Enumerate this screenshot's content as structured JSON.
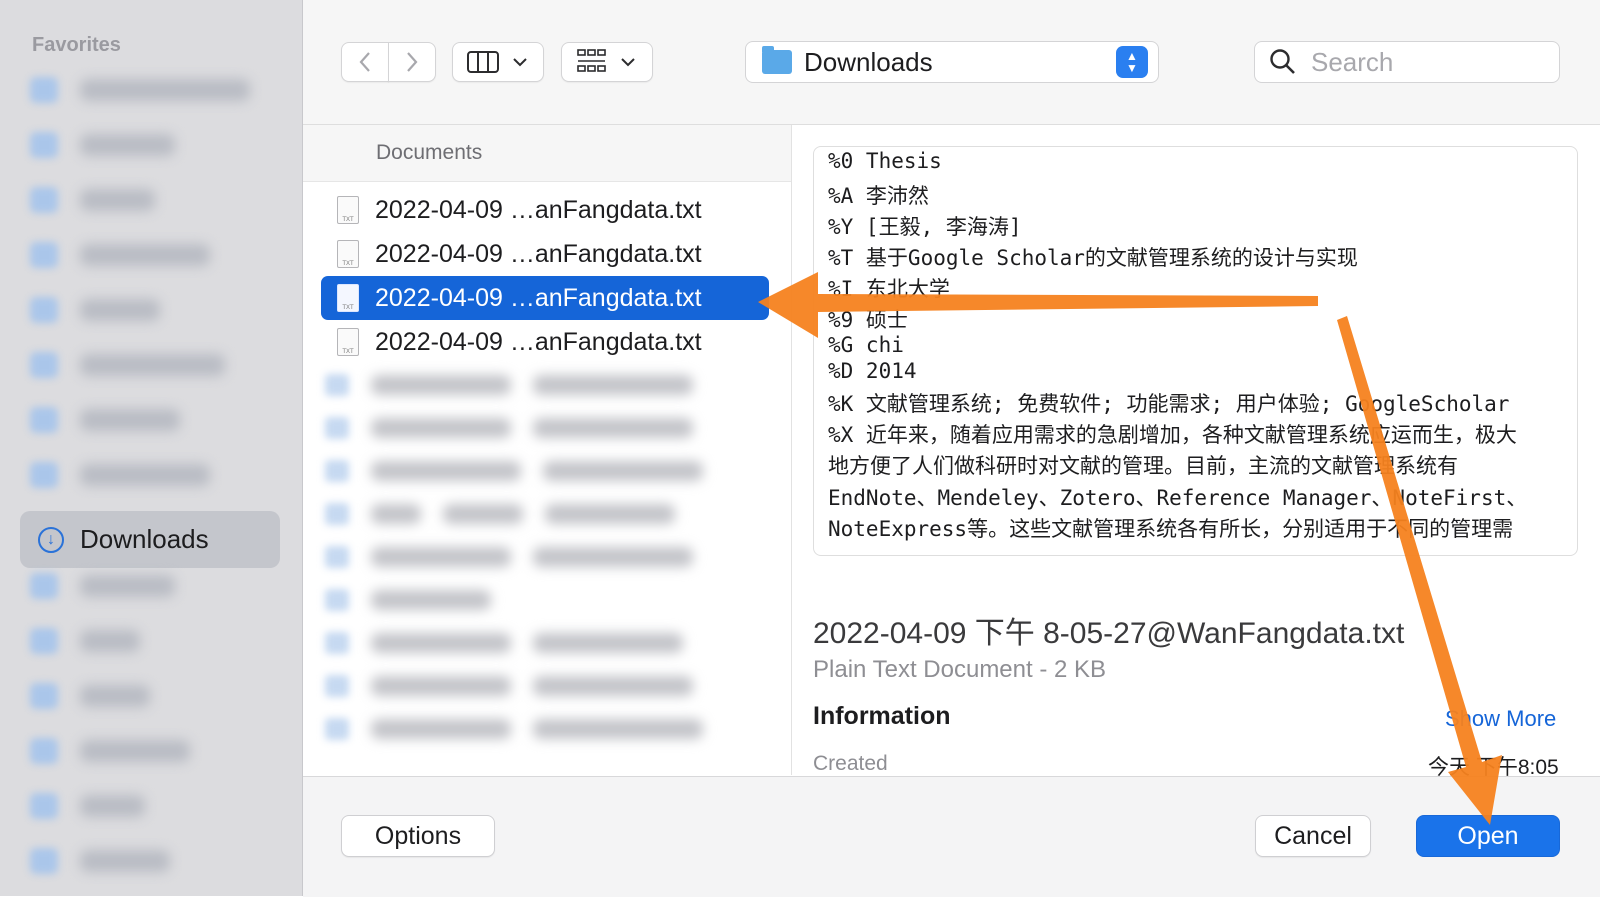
{
  "sidebar": {
    "section_title": "Favorites",
    "active_item": {
      "label": "Downloads",
      "icon": "download-icon"
    }
  },
  "toolbar": {
    "back_icon": "chevron-left-icon",
    "forward_icon": "chevron-right-icon",
    "view_mode_icon": "columns-icon",
    "group_icon": "grid-icon",
    "location": "Downloads",
    "search_placeholder": "Search"
  },
  "file_column": {
    "header": "Documents",
    "files": [
      {
        "name": "2022-04-09 …anFangdata.txt",
        "selected": false
      },
      {
        "name": "2022-04-09 …anFangdata.txt",
        "selected": false
      },
      {
        "name": "2022-04-09 …anFangdata.txt",
        "selected": true
      },
      {
        "name": "2022-04-09 …anFangdata.txt",
        "selected": false
      }
    ],
    "file_icon_label": "TXT"
  },
  "preview": {
    "lines": [
      "%0 Thesis",
      "%A 李沛然",
      "%Y [王毅, 李海涛]",
      "%T 基于Google Scholar的文献管理系统的设计与实现",
      "%I 东北大学",
      "%9 硕士",
      "%G chi",
      "%D 2014",
      "%K 文献管理系统; 免费软件; 功能需求; 用户体验; GoogleScholar",
      "%X 近年来，随着应用需求的急剧增加，各种文献管理系统应运而生，极大",
      "地方便了人们做科研时对文献的管理。目前，主流的文献管理系统有",
      "EndNote、Mendeley、Zotero、Reference Manager、NoteFirst、",
      "NoteExpress等。这些文献管理系统各有所长，分别适用于不同的管理需"
    ],
    "file_title": "2022-04-09 下午 8-05-27@WanFangdata.txt",
    "file_subtitle": "Plain Text Document - 2 KB",
    "info_heading": "Information",
    "show_more": "Show More",
    "created_label": "Created",
    "created_value": "今天 下午8:05"
  },
  "footer": {
    "options_label": "Options",
    "cancel_label": "Cancel",
    "open_label": "Open"
  },
  "annotation_color": "#f5821f"
}
